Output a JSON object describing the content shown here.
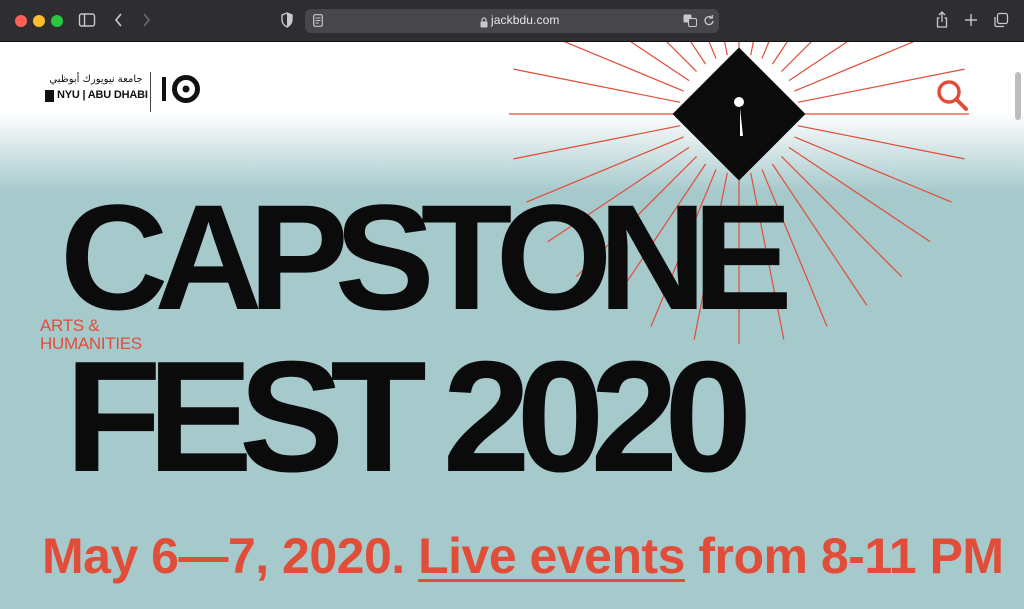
{
  "browser": {
    "url": "jackbdu.com",
    "icons": {
      "sidebar": "sidebar-icon",
      "back": "chevron-left-icon",
      "forward": "chevron-right-icon",
      "privacy": "shield-icon",
      "reader": "reader-icon",
      "lock": "lock-icon",
      "translate": "translate-icon",
      "reload": "reload-icon",
      "share": "share-icon",
      "new_tab": "plus-icon",
      "tabs": "tabs-overview-icon"
    }
  },
  "header": {
    "logo_arabic": "جامعة نيويورك أبوظبي",
    "logo_english": "NYU | ABU DHABI",
    "anniversary_logo": "10"
  },
  "hero": {
    "subtitle_line1": "ARTS &",
    "subtitle_line2": "HUMANITIES",
    "title_line1": "CAPSTONE",
    "title_line2": "FEST 2020",
    "dates_prefix": "May 6—7, 2020.",
    "dates_link": "Live events",
    "dates_suffix": "from 8-11 PM"
  },
  "colors": {
    "accent": "#e04e39",
    "background": "#a6c9cc",
    "ink": "#0b0b0b"
  }
}
